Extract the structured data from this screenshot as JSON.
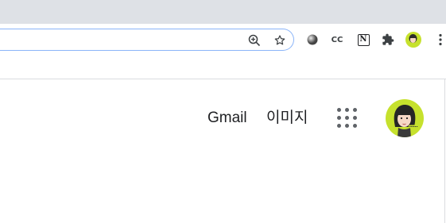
{
  "browser": {
    "extensions": [
      {
        "name": "circle-extension",
        "icon": "gray-circle-icon"
      },
      {
        "name": "cc-extension",
        "label": "CC"
      },
      {
        "name": "notion-extension",
        "label": "N"
      },
      {
        "name": "extensions-menu",
        "icon": "puzzle-icon"
      },
      {
        "name": "profile",
        "icon": "avatar-icon"
      },
      {
        "name": "menu",
        "icon": "kebab-icon"
      }
    ]
  },
  "google_header": {
    "gmail_label": "Gmail",
    "images_label": "이미지",
    "apps_icon": "apps-grid-icon",
    "account_icon": "account-avatar-icon"
  },
  "colors": {
    "tab_strip": "#dee1e6",
    "focus_ring": "#8ab4f8",
    "avatar_bg": "#c6e12d",
    "icon_gray": "#5f6368",
    "text": "#202124"
  }
}
